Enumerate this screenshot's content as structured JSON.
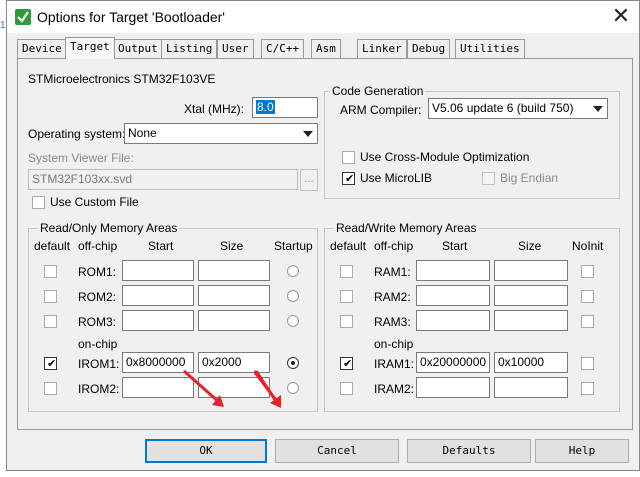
{
  "window": {
    "title": "Options for Target 'Bootloader'",
    "close_glyph": "✕",
    "gutter_digit": "1"
  },
  "tabs": [
    {
      "label": "Device",
      "active": false
    },
    {
      "label": "Target",
      "active": true
    },
    {
      "label": "Output",
      "active": false
    },
    {
      "label": "Listing",
      "active": false
    },
    {
      "label": "User",
      "active": false
    },
    {
      "label": "C/C++",
      "active": false
    },
    {
      "label": "Asm",
      "active": false
    },
    {
      "label": "Linker",
      "active": false
    },
    {
      "label": "Debug",
      "active": false
    },
    {
      "label": "Utilities",
      "active": false
    }
  ],
  "target": {
    "device_name": "STMicroelectronics STM32F103VE",
    "xtal_label": "Xtal (MHz):",
    "xtal_value": "8.0",
    "os_label": "Operating system:",
    "os_value": "None",
    "svd_label": "System Viewer File:",
    "svd_value": "STM32F103xx.svd",
    "svd_browse": "...",
    "custom_file_label": "Use Custom File",
    "custom_file_checked": false
  },
  "code_generation": {
    "title": "Code Generation",
    "compiler_label": "ARM Compiler:",
    "compiler_value": "V5.06 update 6 (build 750)",
    "cross_module_label": "Use Cross-Module Optimization",
    "cross_module_checked": false,
    "microlib_label": "Use MicroLIB",
    "microlib_checked": true,
    "big_endian_label": "Big Endian",
    "big_endian_checked": false
  },
  "ro_memory": {
    "title": "Read/Only Memory Areas",
    "headers": {
      "default": "default",
      "offchip": "off-chip",
      "start": "Start",
      "size": "Size",
      "startup": "Startup"
    },
    "onchip_label": "on-chip",
    "rows": [
      {
        "name": "ROM1:",
        "default": false,
        "start": "",
        "size": "",
        "startup": false
      },
      {
        "name": "ROM2:",
        "default": false,
        "start": "",
        "size": "",
        "startup": false
      },
      {
        "name": "ROM3:",
        "default": false,
        "start": "",
        "size": "",
        "startup": false
      },
      {
        "name": "IROM1:",
        "default": true,
        "start": "0x8000000",
        "size": "0x2000",
        "startup": true
      },
      {
        "name": "IROM2:",
        "default": false,
        "start": "",
        "size": "",
        "startup": false
      }
    ]
  },
  "rw_memory": {
    "title": "Read/Write Memory Areas",
    "headers": {
      "default": "default",
      "offchip": "off-chip",
      "start": "Start",
      "size": "Size",
      "noinit": "NoInit"
    },
    "onchip_label": "on-chip",
    "rows": [
      {
        "name": "RAM1:",
        "default": false,
        "start": "",
        "size": "",
        "noinit": false
      },
      {
        "name": "RAM2:",
        "default": false,
        "start": "",
        "size": "",
        "noinit": false
      },
      {
        "name": "RAM3:",
        "default": false,
        "start": "",
        "size": "",
        "noinit": false
      },
      {
        "name": "IRAM1:",
        "default": true,
        "start": "0x20000000",
        "size": "0x10000",
        "noinit": false
      },
      {
        "name": "IRAM2:",
        "default": false,
        "start": "",
        "size": "",
        "noinit": false
      }
    ]
  },
  "buttons": {
    "ok": "OK",
    "cancel": "Cancel",
    "defaults": "Defaults",
    "help": "Help"
  },
  "colors": {
    "annotation_arrow": "#e8202a",
    "selection": "#0078d7",
    "keil_icon": "#2e9b3e"
  }
}
